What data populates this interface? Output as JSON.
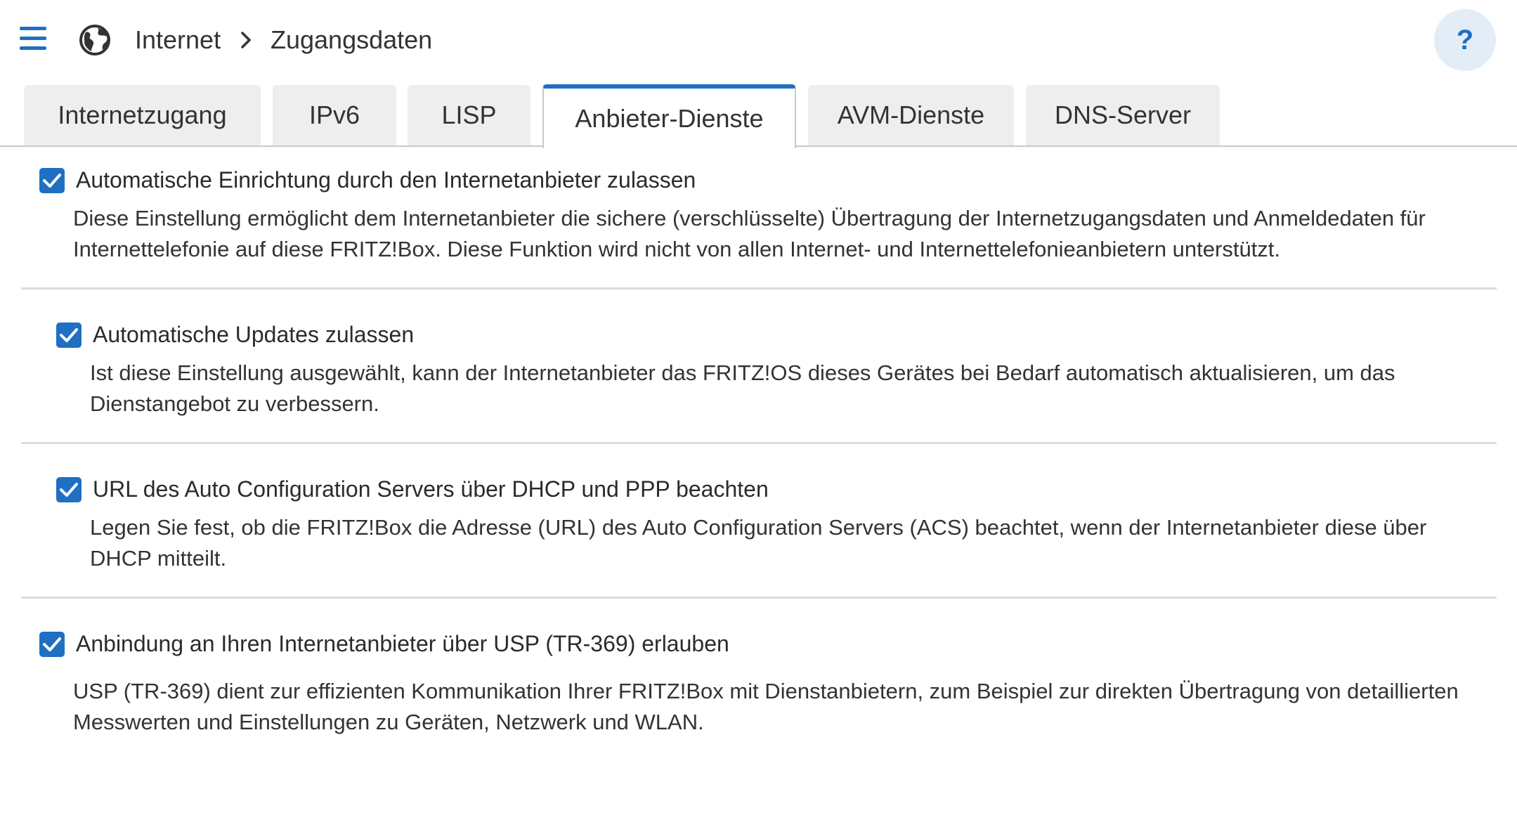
{
  "header": {
    "breadcrumb": [
      {
        "label": "Internet"
      },
      {
        "label": "Zugangsdaten"
      }
    ],
    "help_label": "?"
  },
  "tabs": [
    {
      "label": "Internetzugang",
      "active": false
    },
    {
      "label": "IPv6",
      "active": false
    },
    {
      "label": "LISP",
      "active": false
    },
    {
      "label": "Anbieter-Dienste",
      "active": true
    },
    {
      "label": "AVM-Dienste",
      "active": false
    },
    {
      "label": "DNS-Server",
      "active": false
    }
  ],
  "settings": [
    {
      "label": "Automatische Einrichtung durch den Internetanbieter zulassen",
      "checked": true,
      "description": "Diese Einstellung ermöglicht dem Internetanbieter die sichere (verschlüsselte) Übertragung der Internetzugangsdaten und Anmeldedaten für Internettelefonie auf diese FRITZ!Box. Diese Funktion wird nicht von allen Internet- und Internettelefonieanbietern unterstützt."
    },
    {
      "label": "Automatische Updates zulassen",
      "checked": true,
      "description": "Ist diese Einstellung ausgewählt, kann der Internetanbieter das FRITZ!OS dieses Gerätes bei Bedarf automatisch aktualisieren, um das Dienstangebot zu verbessern."
    },
    {
      "label": "URL des Auto Configuration Servers über DHCP und PPP beachten",
      "checked": true,
      "description": "Legen Sie fest, ob die FRITZ!Box die Adresse (URL) des Auto Configuration Servers (ACS) beachtet, wenn der Internetanbieter diese über DHCP mitteilt."
    },
    {
      "label": "Anbindung an Ihren Internetanbieter über USP (TR-369) erlauben",
      "checked": true,
      "description": "USP (TR-369) dient zur effizienten Kommunikation Ihrer FRITZ!Box mit Dienstanbietern, zum Beispiel zur direkten Übertragung von detaillierten Messwerten und Einstellungen zu Geräten, Netzwerk und WLAN."
    }
  ],
  "colors": {
    "accent": "#1f6fc2",
    "tab_inactive": "#eeeeee",
    "help_bg": "#e3edf8"
  }
}
